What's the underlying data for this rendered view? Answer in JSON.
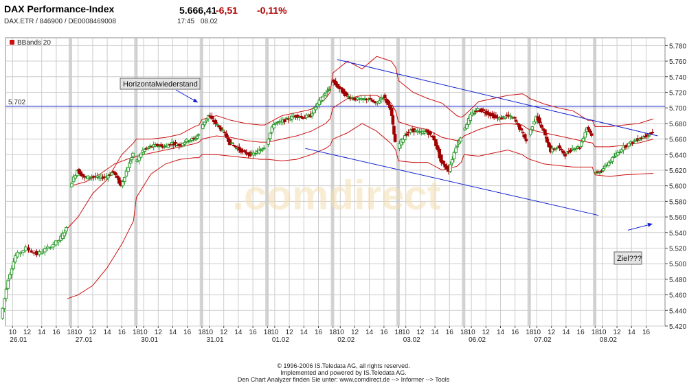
{
  "header": {
    "title": "DAX Performance-Index",
    "symbol_line": "DAX.ETR  /  846900  /  DE0008469008",
    "price": "5.666,41",
    "change": "-6,51",
    "change_pct": "-0,11%",
    "time": "17:45",
    "date": "08.02"
  },
  "colors": {
    "up_candle": "#2a9a2a",
    "down_candle": "#a00000",
    "bands": "#cc1010",
    "trendlines": "#1020d0",
    "session_bars": "#d4d4d4",
    "grid": "#cccccc"
  },
  "chart_data": {
    "type": "candlestick",
    "indicator_label": "BBands 20",
    "ylim": [
      5420,
      5790
    ],
    "y_ticks": [
      "5.780",
      "5.760",
      "5.740",
      "5.720",
      "5.700",
      "5.680",
      "5.660",
      "5.640",
      "5.620",
      "5.600",
      "5.580",
      "5.560",
      "5.540",
      "5.520",
      "5.500",
      "5.480",
      "5.460",
      "5.440",
      "5.420"
    ],
    "y_tick_values": [
      5780,
      5760,
      5740,
      5720,
      5700,
      5680,
      5660,
      5640,
      5620,
      5600,
      5580,
      5560,
      5540,
      5520,
      5500,
      5480,
      5460,
      5440,
      5420
    ],
    "x_tick_hours": [
      "10",
      "12",
      "14",
      "16",
      "18",
      "10",
      "12",
      "14",
      "16",
      "18",
      "10",
      "12",
      "14",
      "16",
      "18",
      "10",
      "12",
      "14",
      "16",
      "18",
      "10",
      "12",
      "14",
      "16",
      "18",
      "10",
      "12",
      "14",
      "16",
      "18",
      "10",
      "12",
      "14",
      "16",
      "18",
      "10",
      "12",
      "14",
      "16",
      "18",
      "10",
      "12",
      "14",
      "16",
      "18",
      "10",
      "12",
      "14",
      "16"
    ],
    "day_labels": [
      "26.01",
      "27.01",
      "30.01",
      "31.01",
      "01.02",
      "02.02",
      "03.02",
      "06.02",
      "07.02",
      "08.02"
    ],
    "horizontal_level": {
      "label": "5.702",
      "value": 5702
    },
    "trend_upper": {
      "from": {
        "day": 5,
        "hour": 9.6,
        "value": 5762
      },
      "to": {
        "day": 9,
        "hour": 17.6,
        "value": 5664
      }
    },
    "trend_lower": {
      "from": {
        "day": 4,
        "hour": 14.2,
        "value": 5648
      },
      "to": {
        "day": 9,
        "hour": 9.5,
        "value": 5562
      }
    },
    "annotations": [
      {
        "text": "Horizontalwiederstand",
        "arrow_to": {
          "day": 2,
          "hour": 17,
          "value": 5702
        }
      },
      {
        "text": "Ziel???",
        "arrow_from": {
          "day": 9,
          "hour": 13.5,
          "value": 5543
        },
        "arrow_to": {
          "day": 9,
          "hour": 16.8,
          "value": 5551
        }
      }
    ],
    "price_path": [
      [
        0,
        8.5,
        5430
      ],
      [
        0,
        9.5,
        5480
      ],
      [
        0,
        10.5,
        5510
      ],
      [
        0,
        12,
        5520
      ],
      [
        0,
        13.5,
        5512
      ],
      [
        0,
        15,
        5520
      ],
      [
        0,
        16.5,
        5530
      ],
      [
        0,
        17.5,
        5545
      ],
      [
        1,
        9,
        5600
      ],
      [
        1,
        10,
        5620
      ],
      [
        1,
        11,
        5610
      ],
      [
        1,
        12,
        5612
      ],
      [
        1,
        13,
        5610
      ],
      [
        1,
        14,
        5612
      ],
      [
        1,
        15,
        5618
      ],
      [
        1,
        16,
        5600
      ],
      [
        1,
        17,
        5625
      ],
      [
        1,
        17.6,
        5640
      ],
      [
        2,
        9,
        5630
      ],
      [
        2,
        10,
        5645
      ],
      [
        2,
        11,
        5650
      ],
      [
        2,
        12,
        5652
      ],
      [
        2,
        13,
        5650
      ],
      [
        2,
        14,
        5655
      ],
      [
        2,
        15,
        5652
      ],
      [
        2,
        16,
        5658
      ],
      [
        2,
        17,
        5660
      ],
      [
        2,
        17.6,
        5665
      ],
      [
        3,
        9,
        5675
      ],
      [
        3,
        10,
        5690
      ],
      [
        3,
        11,
        5680
      ],
      [
        3,
        12,
        5670
      ],
      [
        3,
        13,
        5655
      ],
      [
        3,
        14,
        5648
      ],
      [
        3,
        15,
        5642
      ],
      [
        3,
        16,
        5640
      ],
      [
        3,
        17,
        5645
      ],
      [
        3,
        17.6,
        5650
      ],
      [
        4,
        9,
        5655
      ],
      [
        4,
        10,
        5680
      ],
      [
        4,
        11,
        5682
      ],
      [
        4,
        12,
        5686
      ],
      [
        4,
        13,
        5690
      ],
      [
        4,
        14,
        5688
      ],
      [
        4,
        15,
        5690
      ],
      [
        4,
        16,
        5705
      ],
      [
        4,
        17,
        5718
      ],
      [
        4,
        17.6,
        5725
      ],
      [
        5,
        9,
        5735
      ],
      [
        5,
        10,
        5725
      ],
      [
        5,
        11,
        5715
      ],
      [
        5,
        12,
        5712
      ],
      [
        5,
        13,
        5710
      ],
      [
        5,
        14,
        5712
      ],
      [
        5,
        15,
        5705
      ],
      [
        5,
        16,
        5715
      ],
      [
        5,
        17,
        5700
      ],
      [
        5,
        17.6,
        5655
      ],
      [
        6,
        9,
        5650
      ],
      [
        6,
        10,
        5665
      ],
      [
        6,
        11,
        5672
      ],
      [
        6,
        12,
        5668
      ],
      [
        6,
        13,
        5670
      ],
      [
        6,
        14,
        5660
      ],
      [
        6,
        15,
        5630
      ],
      [
        6,
        16,
        5620
      ],
      [
        6,
        17,
        5650
      ],
      [
        6,
        17.6,
        5662
      ],
      [
        7,
        9,
        5670
      ],
      [
        7,
        10,
        5690
      ],
      [
        7,
        11,
        5698
      ],
      [
        7,
        12,
        5695
      ],
      [
        7,
        13,
        5690
      ],
      [
        7,
        14,
        5686
      ],
      [
        7,
        15,
        5690
      ],
      [
        7,
        16,
        5686
      ],
      [
        7,
        17,
        5670
      ],
      [
        7,
        17.6,
        5658
      ],
      [
        8,
        9,
        5665
      ],
      [
        8,
        10,
        5690
      ],
      [
        8,
        11,
        5670
      ],
      [
        8,
        12,
        5645
      ],
      [
        8,
        13,
        5650
      ],
      [
        8,
        14,
        5640
      ],
      [
        8,
        15,
        5648
      ],
      [
        8,
        16,
        5650
      ],
      [
        8,
        17,
        5675
      ],
      [
        8,
        17.6,
        5666
      ],
      [
        9,
        9,
        5615
      ],
      [
        9,
        10,
        5620
      ],
      [
        9,
        11,
        5630
      ],
      [
        9,
        12,
        5640
      ],
      [
        9,
        13,
        5650
      ],
      [
        9,
        14,
        5655
      ],
      [
        9,
        15,
        5660
      ],
      [
        9,
        16,
        5664
      ],
      [
        9,
        17,
        5668
      ]
    ],
    "bollinger": {
      "upper": [
        [
          1,
          8.5,
          5545
        ],
        [
          1,
          10,
          5560
        ],
        [
          1,
          12,
          5590
        ],
        [
          1,
          14,
          5608
        ],
        [
          1,
          16,
          5640
        ],
        [
          1,
          17.6,
          5655
        ],
        [
          2,
          9,
          5660
        ],
        [
          2,
          11,
          5660
        ],
        [
          2,
          13,
          5662
        ],
        [
          2,
          15,
          5666
        ],
        [
          2,
          17,
          5676
        ],
        [
          2,
          17.6,
          5678
        ],
        [
          3,
          9,
          5685
        ],
        [
          3,
          11,
          5690
        ],
        [
          3,
          13,
          5684
        ],
        [
          3,
          15,
          5680
        ],
        [
          3,
          17,
          5678
        ],
        [
          3,
          17.6,
          5678
        ],
        [
          4,
          9,
          5680
        ],
        [
          4,
          11,
          5690
        ],
        [
          4,
          13,
          5694
        ],
        [
          4,
          15,
          5698
        ],
        [
          4,
          17,
          5712
        ],
        [
          4,
          17.6,
          5720
        ],
        [
          5,
          9,
          5745
        ],
        [
          5,
          11,
          5760
        ],
        [
          5,
          13,
          5750
        ],
        [
          5,
          15,
          5766
        ],
        [
          5,
          17,
          5760
        ],
        [
          5,
          17.6,
          5752
        ],
        [
          6,
          9,
          5735
        ],
        [
          6,
          11,
          5720
        ],
        [
          6,
          13,
          5712
        ],
        [
          6,
          15,
          5706
        ],
        [
          6,
          17,
          5690
        ],
        [
          6,
          17.6,
          5688
        ],
        [
          7,
          9,
          5690
        ],
        [
          7,
          11,
          5708
        ],
        [
          7,
          13,
          5712
        ],
        [
          7,
          15,
          5716
        ],
        [
          7,
          17,
          5718
        ],
        [
          7,
          17.6,
          5715
        ],
        [
          8,
          9,
          5712
        ],
        [
          8,
          11,
          5705
        ],
        [
          8,
          13,
          5700
        ],
        [
          8,
          15,
          5696
        ],
        [
          8,
          17,
          5684
        ],
        [
          8,
          17.6,
          5684
        ],
        [
          9,
          9,
          5676
        ],
        [
          9,
          11,
          5676
        ],
        [
          9,
          13,
          5678
        ],
        [
          9,
          15,
          5680
        ],
        [
          9,
          17,
          5686
        ]
      ],
      "middle": [
        [
          1,
          9,
          5600
        ],
        [
          1,
          11,
          5605
        ],
        [
          1,
          13,
          5615
        ],
        [
          1,
          15,
          5628
        ],
        [
          1,
          17,
          5635
        ],
        [
          1,
          17.6,
          5636
        ],
        [
          2,
          9,
          5638
        ],
        [
          2,
          11,
          5642
        ],
        [
          2,
          13,
          5646
        ],
        [
          2,
          15,
          5650
        ],
        [
          2,
          17,
          5654
        ],
        [
          2,
          17.6,
          5656
        ],
        [
          3,
          9,
          5660
        ],
        [
          3,
          11,
          5664
        ],
        [
          3,
          13,
          5662
        ],
        [
          3,
          15,
          5658
        ],
        [
          3,
          17,
          5656
        ],
        [
          3,
          17.6,
          5656
        ],
        [
          4,
          9,
          5656
        ],
        [
          4,
          11,
          5660
        ],
        [
          4,
          13,
          5664
        ],
        [
          4,
          15,
          5670
        ],
        [
          4,
          17,
          5680
        ],
        [
          4,
          17.6,
          5686
        ],
        [
          5,
          9,
          5700
        ],
        [
          5,
          11,
          5712
        ],
        [
          5,
          13,
          5716
        ],
        [
          5,
          15,
          5716
        ],
        [
          5,
          17,
          5706
        ],
        [
          5,
          17.6,
          5696
        ],
        [
          6,
          9,
          5682
        ],
        [
          6,
          11,
          5676
        ],
        [
          6,
          13,
          5672
        ],
        [
          6,
          15,
          5662
        ],
        [
          6,
          17,
          5658
        ],
        [
          6,
          17.6,
          5660
        ],
        [
          7,
          9,
          5664
        ],
        [
          7,
          11,
          5672
        ],
        [
          7,
          13,
          5678
        ],
        [
          7,
          15,
          5680
        ],
        [
          7,
          17,
          5678
        ],
        [
          7,
          17.6,
          5674
        ],
        [
          8,
          9,
          5672
        ],
        [
          8,
          11,
          5668
        ],
        [
          8,
          13,
          5664
        ],
        [
          8,
          15,
          5660
        ],
        [
          8,
          17,
          5656
        ],
        [
          8,
          17.6,
          5655
        ],
        [
          9,
          9,
          5650
        ],
        [
          9,
          11,
          5650
        ],
        [
          9,
          13,
          5652
        ],
        [
          9,
          15,
          5655
        ],
        [
          9,
          17,
          5660
        ]
      ],
      "lower": [
        [
          1,
          8.5,
          5455
        ],
        [
          1,
          10,
          5460
        ],
        [
          1,
          12,
          5472
        ],
        [
          1,
          14,
          5495
        ],
        [
          1,
          16,
          5525
        ],
        [
          1,
          17.6,
          5555
        ],
        [
          2,
          9,
          5585
        ],
        [
          2,
          11,
          5615
        ],
        [
          2,
          13,
          5628
        ],
        [
          2,
          15,
          5634
        ],
        [
          2,
          17,
          5636
        ],
        [
          2,
          17.6,
          5636
        ],
        [
          3,
          9,
          5640
        ],
        [
          3,
          11,
          5640
        ],
        [
          3,
          13,
          5638
        ],
        [
          3,
          15,
          5636
        ],
        [
          3,
          17,
          5634
        ],
        [
          3,
          17.6,
          5634
        ],
        [
          4,
          9,
          5634
        ],
        [
          4,
          11,
          5632
        ],
        [
          4,
          13,
          5634
        ],
        [
          4,
          15,
          5640
        ],
        [
          4,
          17,
          5648
        ],
        [
          4,
          17.6,
          5652
        ],
        [
          5,
          9,
          5660
        ],
        [
          5,
          11,
          5668
        ],
        [
          5,
          13,
          5680
        ],
        [
          5,
          15,
          5670
        ],
        [
          5,
          17,
          5654
        ],
        [
          5,
          17.6,
          5646
        ],
        [
          6,
          9,
          5632
        ],
        [
          6,
          11,
          5630
        ],
        [
          6,
          13,
          5630
        ],
        [
          6,
          15,
          5620
        ],
        [
          6,
          17,
          5625
        ],
        [
          6,
          17.6,
          5630
        ],
        [
          7,
          9,
          5640
        ],
        [
          7,
          11,
          5638
        ],
        [
          7,
          13,
          5642
        ],
        [
          7,
          15,
          5646
        ],
        [
          7,
          17,
          5640
        ],
        [
          7,
          17.6,
          5636
        ],
        [
          8,
          9,
          5634
        ],
        [
          8,
          11,
          5628
        ],
        [
          8,
          13,
          5626
        ],
        [
          8,
          15,
          5624
        ],
        [
          8,
          17,
          5624
        ],
        [
          8,
          17.6,
          5624
        ],
        [
          9,
          9,
          5614
        ],
        [
          9,
          11,
          5612
        ],
        [
          9,
          13,
          5614
        ],
        [
          9,
          15,
          5615
        ],
        [
          9,
          17,
          5616
        ]
      ]
    }
  },
  "watermark": ".comdirect",
  "footer": {
    "line1": "© 1996-2006 IS.Teledata AG, all rights reserved.",
    "line2": "Implemented and powered by IS.Teledata AG.",
    "line3": "Den Chart Analyzer finden Sie unter: www.comdirect.de --> Informer --> Tools"
  }
}
